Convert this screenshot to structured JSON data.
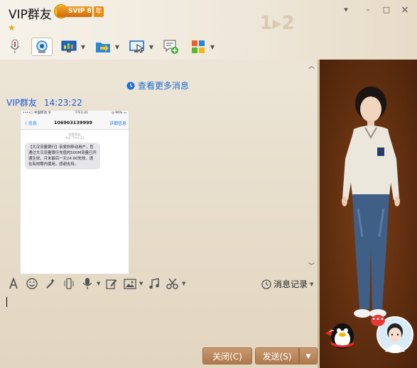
{
  "window": {
    "title": "VIP群友",
    "vip_badge": "SVIP 8",
    "year_badge": "年"
  },
  "titlebar": {
    "minimize": "–",
    "maximize": "□",
    "close": "×",
    "dropdown": "▾"
  },
  "watermark": "1▸2",
  "toolbar": {
    "items": [
      {
        "name": "microphone-icon"
      },
      {
        "name": "webcam-icon"
      },
      {
        "name": "screen-share-icon"
      },
      {
        "name": "file-transfer-icon"
      },
      {
        "name": "remote-assist-icon"
      },
      {
        "name": "send-sms-icon"
      },
      {
        "name": "apps-icon"
      }
    ]
  },
  "chat": {
    "more_messages": "查看更多消息",
    "sender": "VIP群友",
    "time": "14:23:22",
    "image": {
      "carrier": "••••○ 中国移动 令",
      "clock": "下午1:41",
      "battery": "◎ 96% ▭",
      "back": "〈 信息",
      "number": "106903139999",
      "detail": "详细信息",
      "sub_line1": "信息/彩信",
      "sub_line2": "今天 下午1:33",
      "sms": "【大汉流量银行】亲爱的移动用户，您通过大汉流量银行充值的500M流量已开通生效，月末最后一天24:00失效，请在有效期内使用，感谢支持。"
    }
  },
  "input_toolbar": {
    "tools": [
      "font-icon",
      "emoji-icon",
      "magic-wand-icon",
      "shake-icon",
      "voice-icon",
      "edit-icon",
      "image-icon",
      "music-icon",
      "screenshot-icon"
    ],
    "history": "消息记录"
  },
  "buttons": {
    "close": "关闭(C)",
    "send": "发送(S)"
  }
}
